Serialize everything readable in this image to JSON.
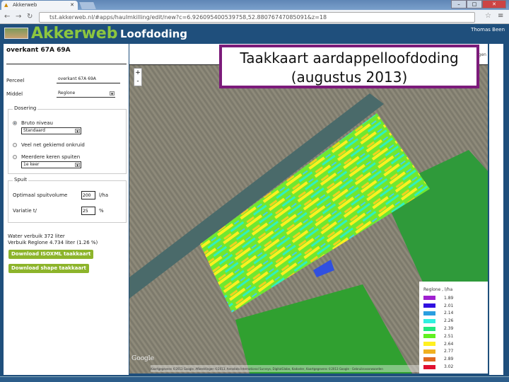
{
  "browser": {
    "tab_title": "Akkerweb",
    "url": "tst.akkerweb.nl/#apps/hauImkilling/edit/new?c=6.926095400539758,52.88076747085091&z=18"
  },
  "header": {
    "brand": "Akkerweb",
    "app": "Loofdoding",
    "user": "Thomas Been"
  },
  "panel": {
    "title": "overkant 67A 69A",
    "perceel_label": "Perceel",
    "perceel_value": "overkant 67A 69A",
    "middel_label": "Middel",
    "middel_value": "Reglone",
    "dosering_legend": "Dosering",
    "opt1": "Bruto niveau",
    "opt1_select": "Standaard",
    "opt2": "Veel net gekiemd onkruid",
    "opt3": "Meerdere keren spuiten",
    "opt3_select": "1e keer",
    "spuit_legend": "Spuit",
    "volume_label": "Optimaal spuitvolume",
    "volume_value": "200",
    "volume_unit": "l/ha",
    "variatie_label": "Variatie t/",
    "variatie_value": "25",
    "variatie_unit": "%",
    "water": "Water verbuik 372 liter",
    "verbruik": "Verbuik Reglone 4.734 liter (1.26 %)",
    "btn_isoxml": "Download ISOXML taakkaart",
    "btn_shape": "Download shape taakkaart"
  },
  "map": {
    "layers_label": "ert lagen",
    "zoom_in": "+",
    "zoom_out": "-",
    "google": "Google",
    "attribution": "Kaartgegevens ©2013 Google, Afbeeldingen ©2013, Aerodata International Surveys, DigitalGlobe, Kadaster, Kaartgegevens ©2013 Google - Gebruiksvoorwaarden"
  },
  "legend": {
    "title": "Reglone , l/ha",
    "items": [
      {
        "value": "1.89",
        "color": "#a020d0"
      },
      {
        "value": "2.01",
        "color": "#3010e0"
      },
      {
        "value": "2.14",
        "color": "#2a9ee0"
      },
      {
        "value": "2.26",
        "color": "#30f0e0"
      },
      {
        "value": "2.39",
        "color": "#20e880"
      },
      {
        "value": "2.51",
        "color": "#60f020"
      },
      {
        "value": "2.64",
        "color": "#fff020"
      },
      {
        "value": "2.77",
        "color": "#f0b020"
      },
      {
        "value": "2.89",
        "color": "#e06820"
      },
      {
        "value": "3.02",
        "color": "#e01030"
      }
    ]
  },
  "overlay": {
    "line1": "Taakkaart aardappelloofdoding",
    "line2": "(augustus 2013)"
  }
}
